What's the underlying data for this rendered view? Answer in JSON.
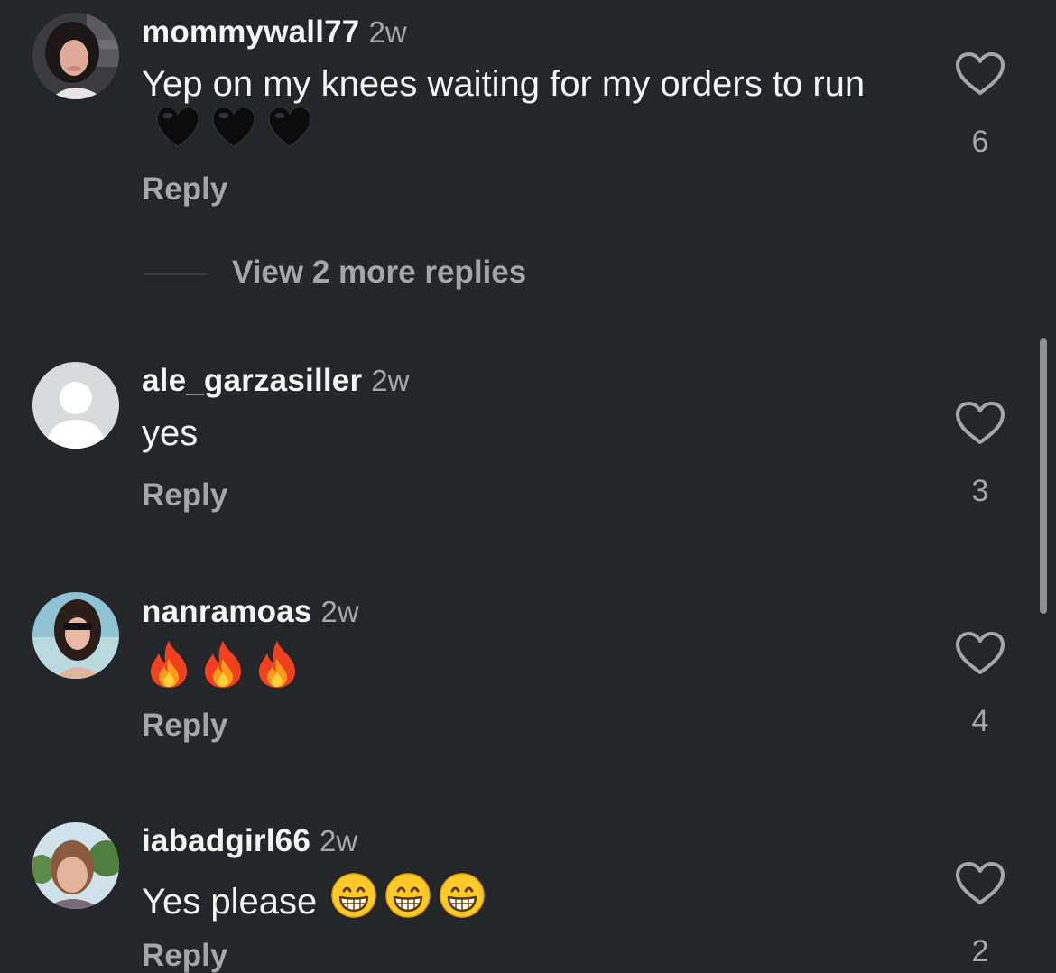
{
  "comments": [
    {
      "username": "mommywall77",
      "time": "2w",
      "text": "Yep on my knees waiting for my orders to run",
      "emoji": [
        "black-heart",
        "black-heart",
        "black-heart"
      ],
      "reply_label": "Reply",
      "likes": "6",
      "more_replies": "View 2 more replies"
    },
    {
      "username": "ale_garzasiller",
      "time": "2w",
      "text": "yes",
      "emoji": [],
      "reply_label": "Reply",
      "likes": "3"
    },
    {
      "username": "nanramoas",
      "time": "2w",
      "text": "",
      "emoji": [
        "fire",
        "fire",
        "fire"
      ],
      "reply_label": "Reply",
      "likes": "4"
    },
    {
      "username": "iabadgirl66",
      "time": "2w",
      "text": "Yes please",
      "emoji": [
        "grinning-face",
        "grinning-face",
        "grinning-face"
      ],
      "reply_label": "Reply",
      "likes": "2"
    }
  ],
  "colors": {
    "background": "#25262a",
    "primary_text": "#f4f4f5",
    "secondary_text": "#a5a6ab"
  },
  "icons": {
    "like": "heart-outline-icon",
    "default_avatar": "person-silhouette-icon"
  }
}
